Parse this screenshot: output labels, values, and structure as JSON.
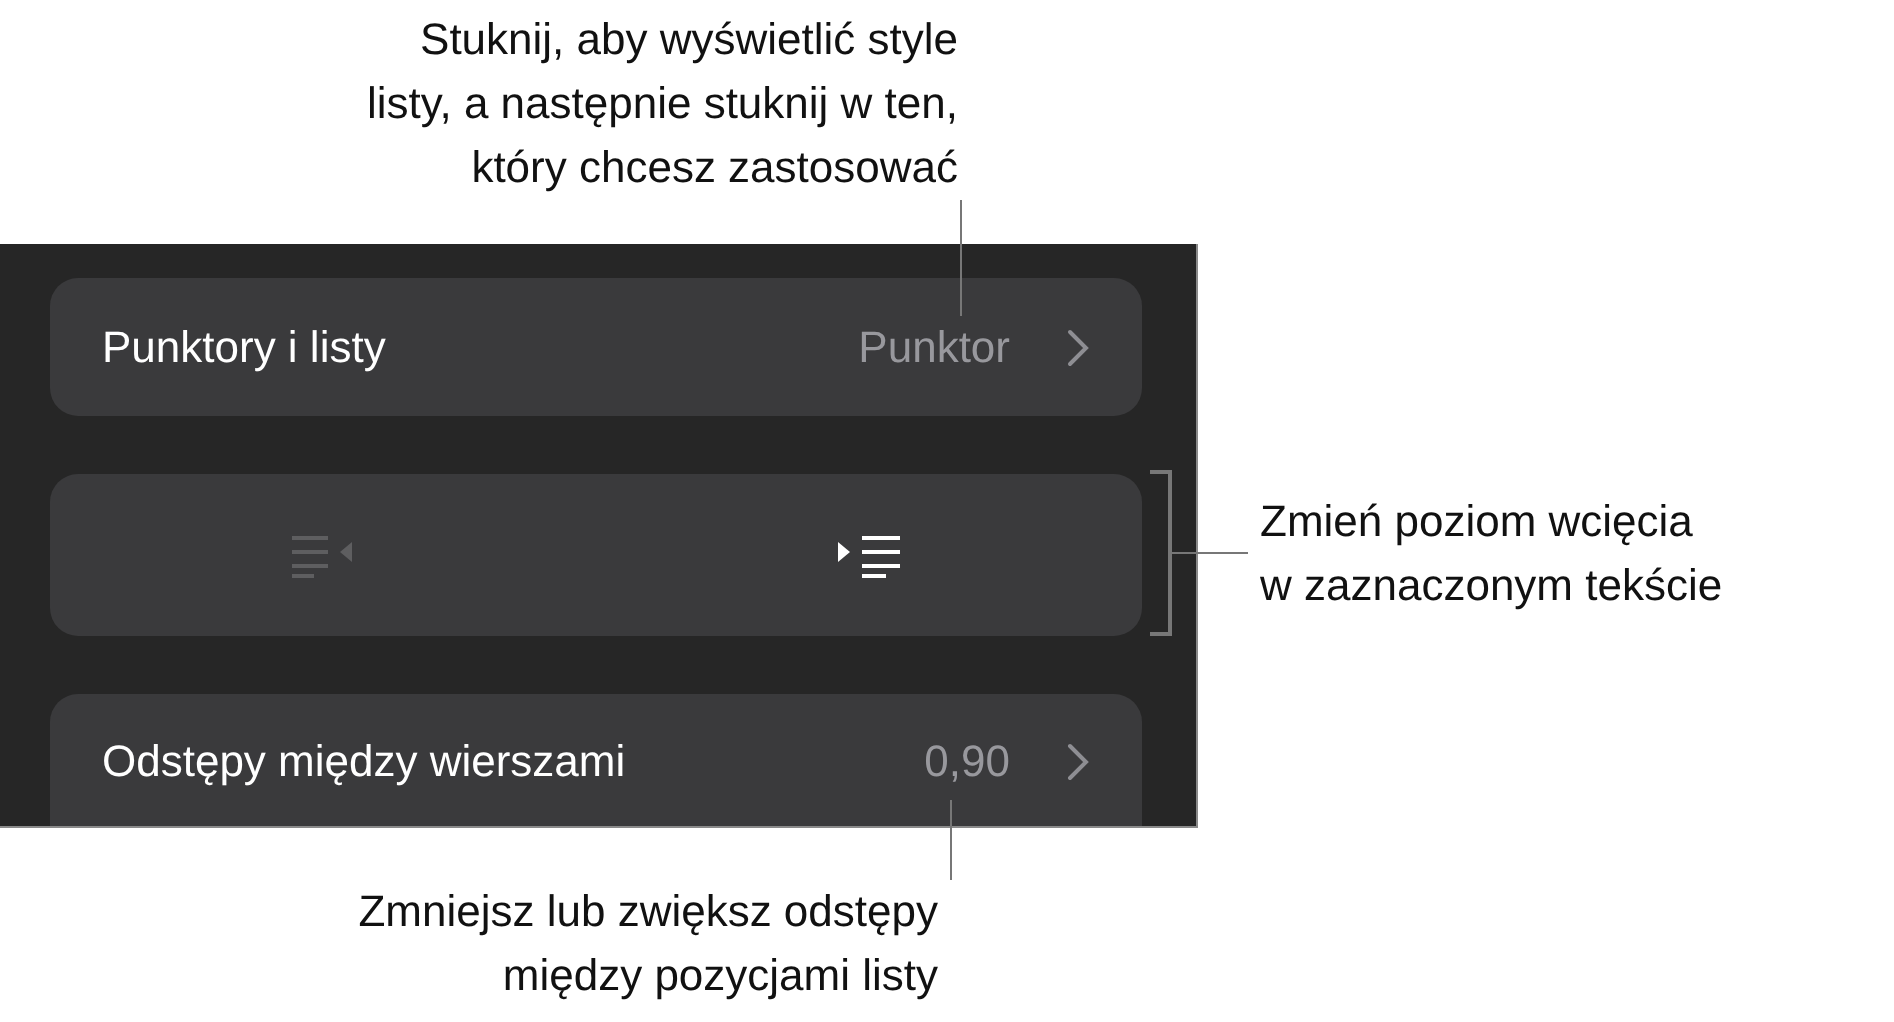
{
  "panel": {
    "rows": [
      {
        "kind": "nav",
        "label": "Punktory i listy",
        "value": "Punktor"
      },
      {
        "kind": "indent",
        "buttons": [
          {
            "kind": "outdent",
            "disabled": true
          },
          {
            "kind": "indent",
            "disabled": false
          }
        ]
      },
      {
        "kind": "nav",
        "label": "Odstępy między wierszami",
        "value": "0,90"
      }
    ]
  },
  "callouts": [
    {
      "kind": "top",
      "lines": [
        "Stuknij, aby wyświetlić style",
        "listy, a następnie stuknij w ten,",
        "który chcesz zastosować"
      ]
    },
    {
      "kind": "right",
      "lines": [
        "Zmień poziom wcięcia",
        "w zaznaczonym tekście"
      ]
    },
    {
      "kind": "bottom",
      "lines": [
        "Zmniejsz lub zwiększ odstępy",
        "między pozycjami listy"
      ]
    }
  ]
}
